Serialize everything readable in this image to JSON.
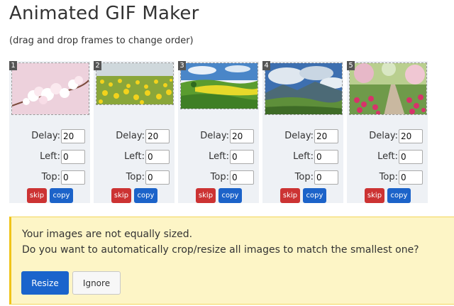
{
  "page": {
    "title": "Animated GIF Maker",
    "subtitle": "(drag and drop frames to change order)"
  },
  "labels": {
    "delay": "Delay:",
    "left": "Left:",
    "top": "Top:",
    "skip": "skip",
    "copy": "copy"
  },
  "frames": [
    {
      "number": "1",
      "image": "cherry-blossom",
      "delay": "20",
      "left": "0",
      "top": "0"
    },
    {
      "number": "2",
      "image": "yellow-flower-field",
      "delay": "20",
      "left": "0",
      "top": "0"
    },
    {
      "number": "3",
      "image": "green-hills-landscape",
      "delay": "20",
      "left": "0",
      "top": "0"
    },
    {
      "number": "4",
      "image": "mountain-valley-clouds",
      "delay": "20",
      "left": "0",
      "top": "0"
    },
    {
      "number": "5",
      "image": "garden-path-flowers",
      "delay": "20",
      "left": "0",
      "top": "0"
    }
  ],
  "alert": {
    "line1": "Your images are not equally sized.",
    "line2": "Do you want to automatically crop/resize all images to match the smallest one?",
    "resize_label": "Resize",
    "ignore_label": "Ignore"
  },
  "colors": {
    "skip": "#cc3333",
    "copy": "#1c63c9",
    "alert_bg": "#fdf5c6",
    "frame_bg": "#eef1f5"
  }
}
